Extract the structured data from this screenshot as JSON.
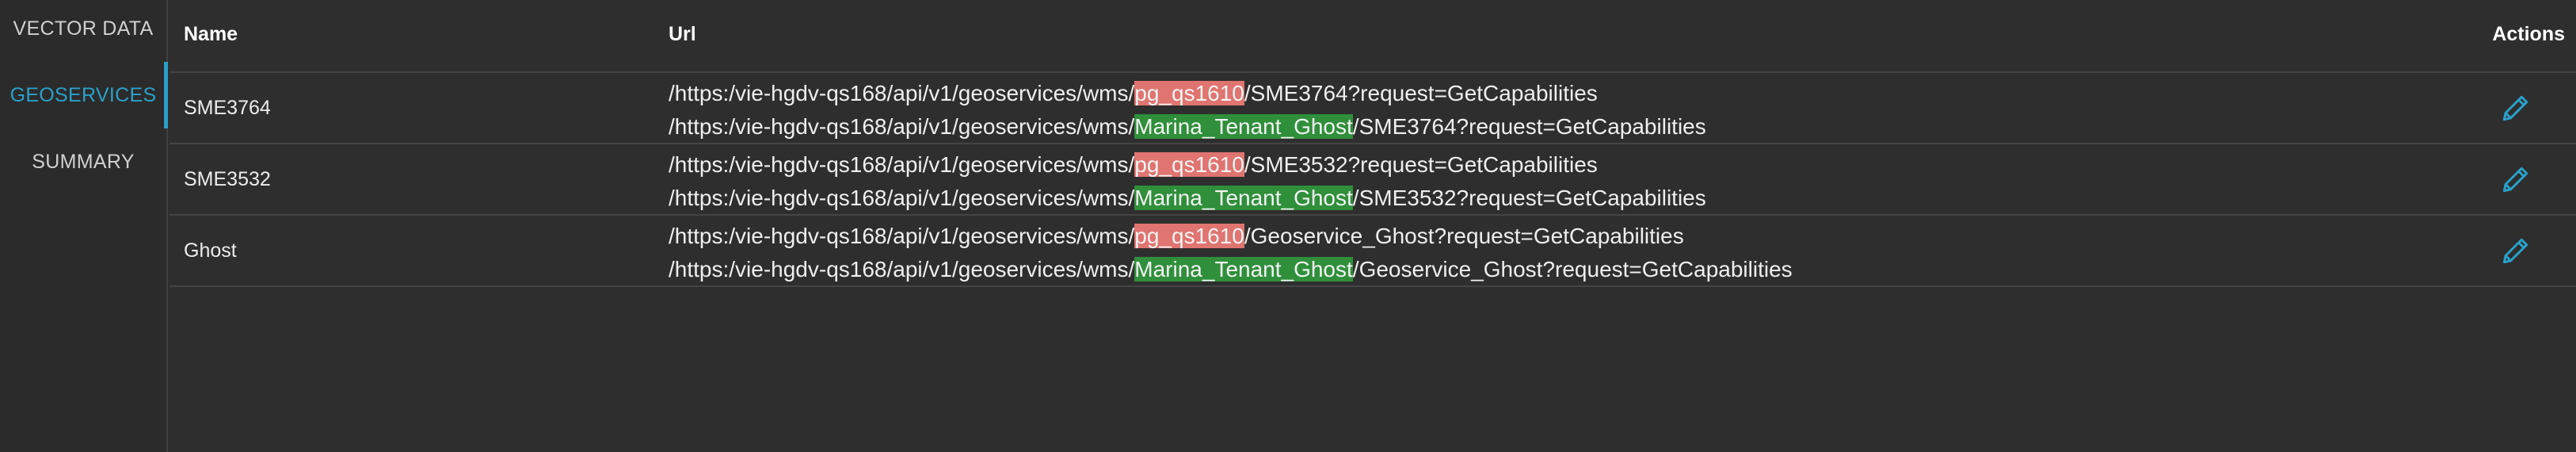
{
  "sidebar": {
    "items": [
      {
        "label": "VECTOR DATA",
        "active": false
      },
      {
        "label": "GEOSERVICES",
        "active": true
      },
      {
        "label": "SUMMARY",
        "active": false
      }
    ],
    "active_color": "#2aa1c9"
  },
  "table": {
    "headers": {
      "name": "Name",
      "url": "Url",
      "actions": "Actions"
    },
    "rows": [
      {
        "name": "SME3764",
        "urls": [
          {
            "prefix": "/https:/vie-hgdv-qs168/api/v1/geoservices/wms/",
            "highlight": "pg_qs1610",
            "highlight_type": "removed",
            "suffix": "/SME3764?request=GetCapabilities"
          },
          {
            "prefix": "/https:/vie-hgdv-qs168/api/v1/geoservices/wms/",
            "highlight": "Marina_Tenant_Ghost",
            "highlight_type": "added",
            "suffix": "/SME3764?request=GetCapabilities"
          }
        ],
        "action_icon": "pencil-icon"
      },
      {
        "name": "SME3532",
        "urls": [
          {
            "prefix": "/https:/vie-hgdv-qs168/api/v1/geoservices/wms/",
            "highlight": "pg_qs1610",
            "highlight_type": "removed",
            "suffix": "/SME3532?request=GetCapabilities"
          },
          {
            "prefix": "/https:/vie-hgdv-qs168/api/v1/geoservices/wms/",
            "highlight": "Marina_Tenant_Ghost",
            "highlight_type": "added",
            "suffix": "/SME3532?request=GetCapabilities"
          }
        ],
        "action_icon": "pencil-icon"
      },
      {
        "name": "Ghost",
        "urls": [
          {
            "prefix": "/https:/vie-hgdv-qs168/api/v1/geoservices/wms/",
            "highlight": "pg_qs1610",
            "highlight_type": "removed",
            "suffix": "/Geoservice_Ghost?request=GetCapabilities"
          },
          {
            "prefix": "/https:/vie-hgdv-qs168/api/v1/geoservices/wms/",
            "highlight": "Marina_Tenant_Ghost",
            "highlight_type": "added",
            "suffix": "/Geoservice_Ghost?request=GetCapabilities"
          }
        ],
        "action_icon": "pencil-icon"
      }
    ]
  },
  "colors": {
    "background": "#2e2e2e",
    "removed_highlight": "#e07470",
    "added_highlight": "#2f8f3a",
    "accent": "#2aa1c9"
  }
}
